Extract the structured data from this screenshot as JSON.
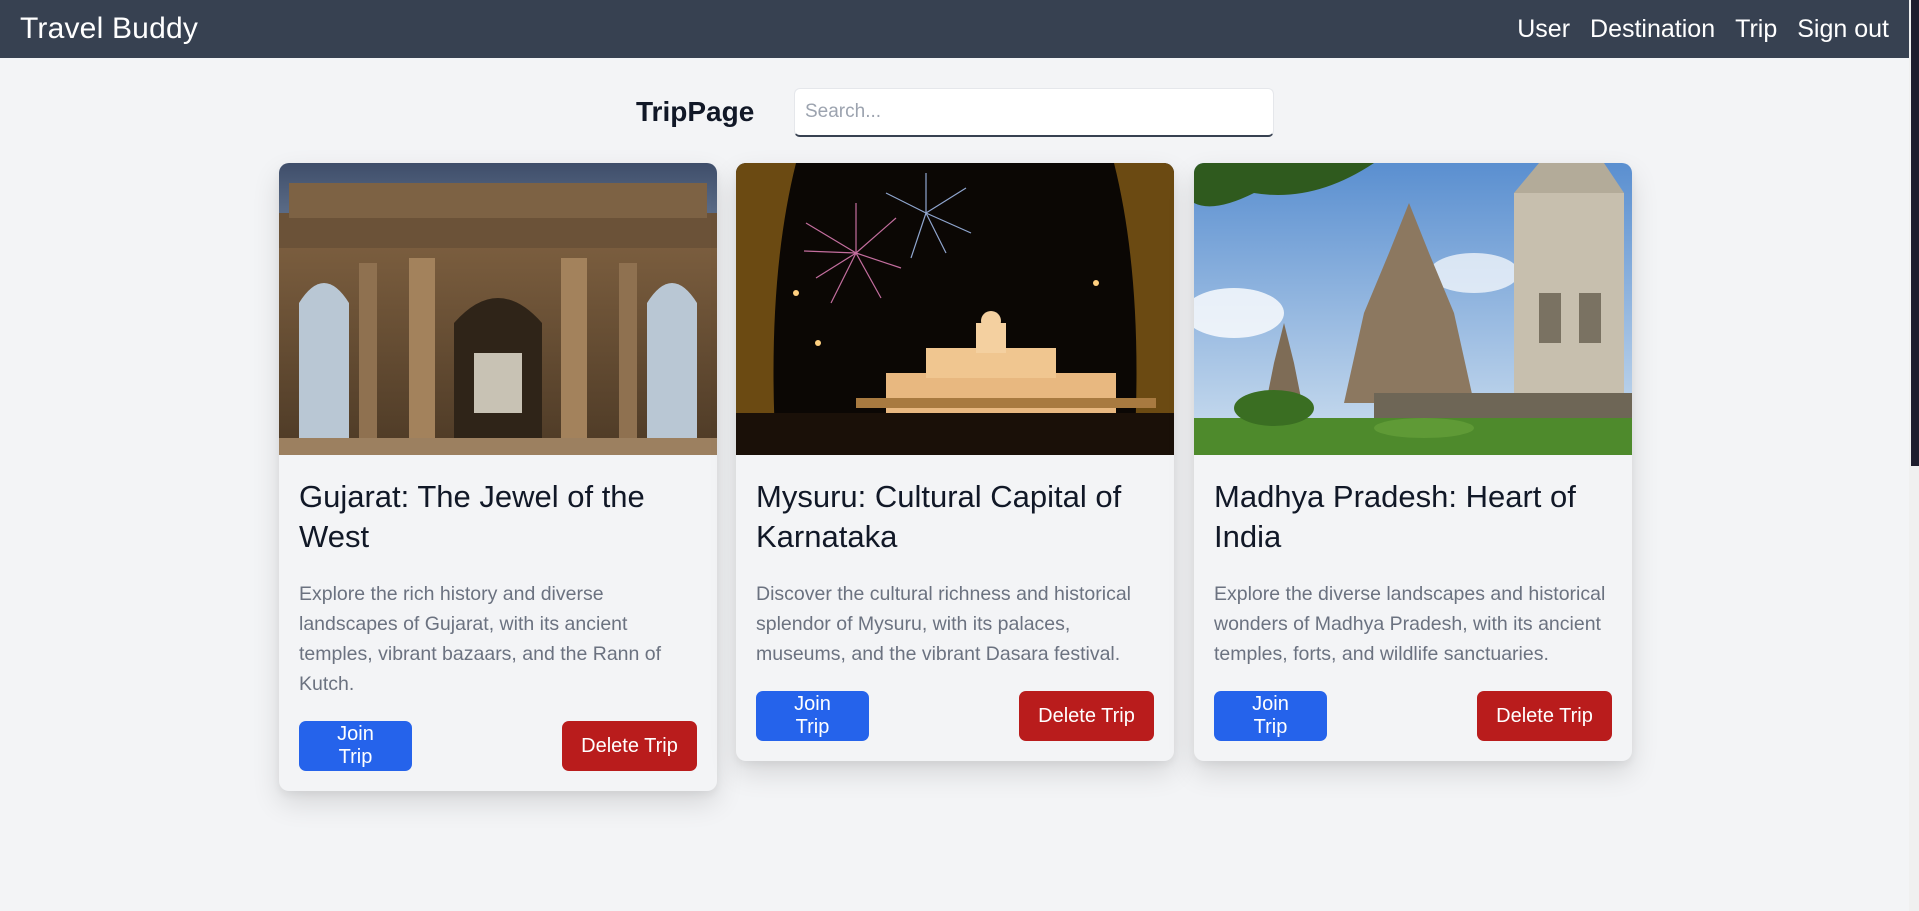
{
  "navbar": {
    "brand": "Travel Buddy",
    "links": [
      "User",
      "Destination",
      "Trip",
      "Sign out"
    ]
  },
  "page": {
    "title": "TripPage",
    "search_placeholder": "Search..."
  },
  "trips": [
    {
      "title": "Gujarat: The Jewel of the West",
      "description": "Explore the rich history and diverse landscapes of Gujarat, with its ancient temples, vibrant bazaars, and the Rann of Kutch.",
      "join_label": "Join Trip",
      "delete_label": "Delete Trip"
    },
    {
      "title": "Mysuru: Cultural Capital of Karnataka",
      "description": "Discover the cultural richness and historical splendor of Mysuru, with its palaces, museums, and the vibrant Dasara festival.",
      "join_label": "Join Trip",
      "delete_label": "Delete Trip"
    },
    {
      "title": "Madhya Pradesh: Heart of India",
      "description": "Explore the diverse landscapes and historical wonders of Madhya Pradesh, with its ancient temples, forts, and wildlife sanctuaries.",
      "join_label": "Join Trip",
      "delete_label": "Delete Trip"
    }
  ],
  "colors": {
    "navbar_bg": "#374151",
    "page_bg": "#f3f4f6",
    "join_button": "#2563eb",
    "delete_button": "#b91c1c",
    "description_text": "#6b7280"
  }
}
